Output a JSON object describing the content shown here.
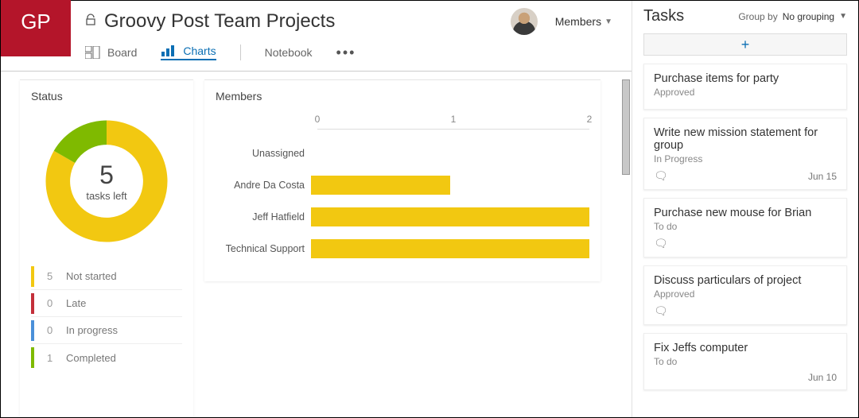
{
  "app": {
    "tile_initials": "GP",
    "title": "Groovy Post Team Projects",
    "members_dropdown": "Members"
  },
  "tabs": {
    "board": "Board",
    "charts": "Charts",
    "notebook": "Notebook"
  },
  "status_card": {
    "title": "Status",
    "center_number": "5",
    "center_label": "tasks left",
    "legend": [
      {
        "count": "5",
        "label": "Not started",
        "color": "#f2c811"
      },
      {
        "count": "0",
        "label": "Late",
        "color": "#c32f3a"
      },
      {
        "count": "0",
        "label": "In progress",
        "color": "#4a90d9"
      },
      {
        "count": "1",
        "label": "Completed",
        "color": "#7fba00"
      }
    ]
  },
  "members_card": {
    "title": "Members"
  },
  "chart_data": {
    "type": "bar",
    "orientation": "horizontal",
    "title": "Members",
    "xlabel": "",
    "ylabel": "",
    "xlim": [
      0,
      2
    ],
    "x_ticks": [
      0,
      1,
      2
    ],
    "categories": [
      "Unassigned",
      "Andre Da Costa",
      "Jeff Hatfield",
      "Technical Support"
    ],
    "values": [
      0,
      1,
      2,
      2
    ],
    "bar_color": "#f2c811",
    "annotations": [],
    "donut": {
      "type": "pie",
      "title": "Status",
      "series": [
        {
          "name": "Not started",
          "value": 5,
          "color": "#f2c811"
        },
        {
          "name": "Late",
          "value": 0,
          "color": "#c32f3a"
        },
        {
          "name": "In progress",
          "value": 0,
          "color": "#4a90d9"
        },
        {
          "name": "Completed",
          "value": 1,
          "color": "#7fba00"
        }
      ],
      "center_value": 5,
      "center_label": "tasks left"
    }
  },
  "tasks_panel": {
    "title": "Tasks",
    "groupby_label": "Group by",
    "groupby_value": "No grouping",
    "add_label": "+",
    "tasks": [
      {
        "title": "Purchase items for party",
        "status": "Approved",
        "has_comment": false,
        "due": ""
      },
      {
        "title": "Write new mission statement for group",
        "status": "In Progress",
        "has_comment": true,
        "due": "Jun 15"
      },
      {
        "title": "Purchase new mouse for Brian",
        "status": "To do",
        "has_comment": true,
        "due": ""
      },
      {
        "title": "Discuss particulars of project",
        "status": "Approved",
        "has_comment": true,
        "due": ""
      },
      {
        "title": "Fix Jeffs computer",
        "status": "To do",
        "has_comment": false,
        "due": "Jun 10"
      }
    ]
  }
}
